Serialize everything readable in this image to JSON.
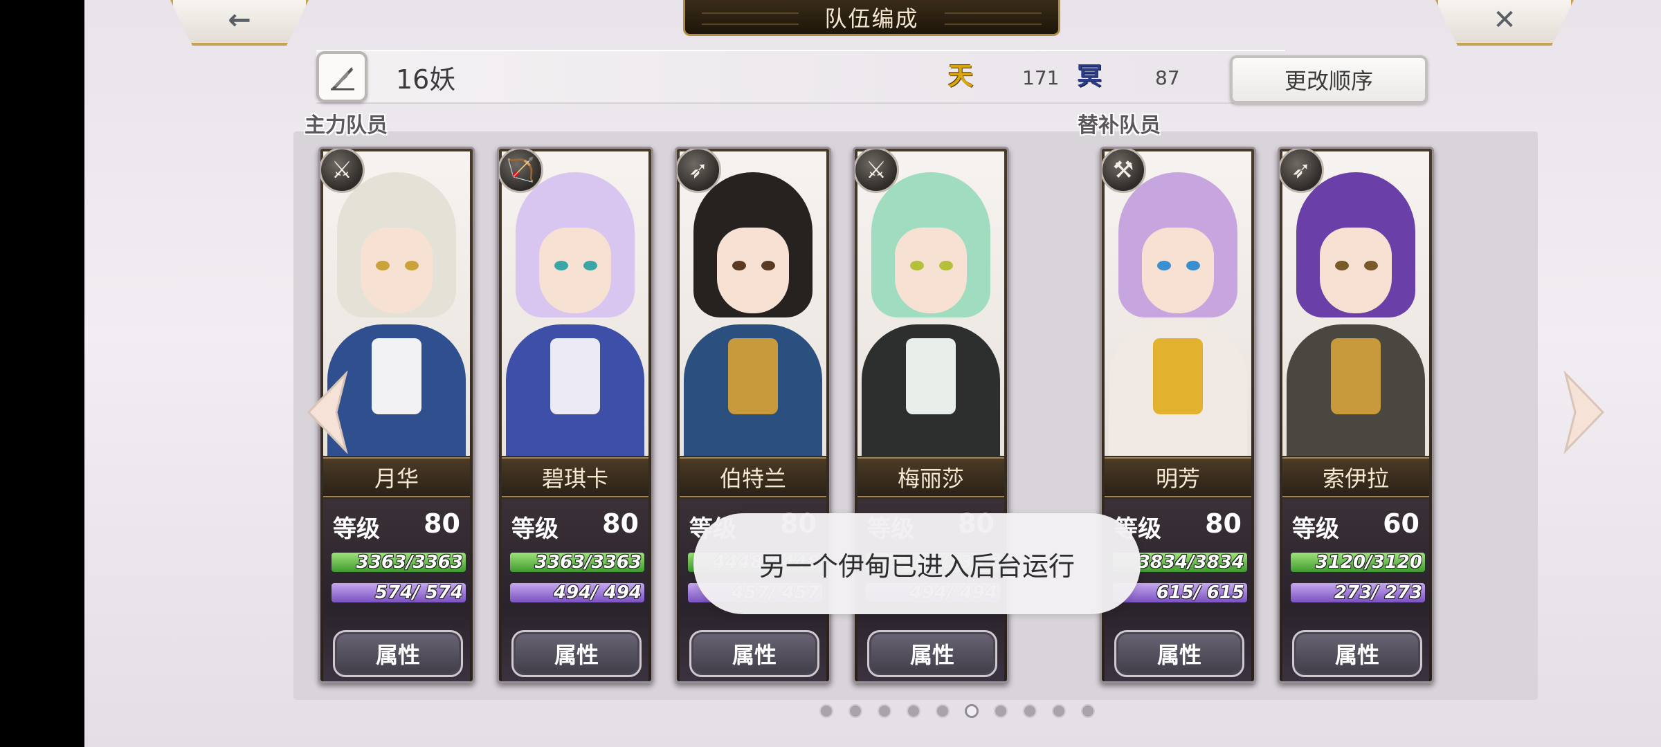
{
  "header": {
    "title": "队伍编成",
    "back_icon": "←",
    "close_icon": "✕"
  },
  "team": {
    "name": "16妖",
    "ten_icon": "天",
    "ten_count": "171",
    "ming_icon": "冥",
    "ming_count": "87",
    "reorder_label": "更改顺序"
  },
  "sections": {
    "main_label": "主力队员",
    "sub_label": "替补队员"
  },
  "cards": [
    {
      "name": "月华",
      "level_label": "等级",
      "level": "80",
      "hp": "3363/3363",
      "mp": "574/ 574",
      "attr_label": "属性",
      "weapon_icon": "⚔",
      "hair": "#e4e2d6",
      "body": "#2f4f8f",
      "accent": "#f2f2f4",
      "eye": "#c9a23a"
    },
    {
      "name": "碧琪卡",
      "level_label": "等级",
      "level": "80",
      "hp": "3363/3363",
      "mp": "494/ 494",
      "attr_label": "属性",
      "weapon_icon": "🏹",
      "hair": "#d9c6f0",
      "body": "#3d4fa6",
      "accent": "#ecebf5",
      "eye": "#3aa6a6"
    },
    {
      "name": "伯特兰",
      "level_label": "等级",
      "level": "80",
      "hp": "4448/4448",
      "mp": "457/ 457",
      "attr_label": "属性",
      "weapon_icon": "➶",
      "hair": "#262220",
      "body": "#2b4f7e",
      "accent": "#c99a3b",
      "eye": "#5a3a22"
    },
    {
      "name": "梅丽莎",
      "level_label": "等级",
      "level": "80",
      "hp": "3363/3363",
      "mp": "494/ 494",
      "attr_label": "属性",
      "weapon_icon": "⚔",
      "hair": "#9fdcc0",
      "body": "#2c2f2e",
      "accent": "#e8eeea",
      "eye": "#b5c03a"
    },
    {
      "name": "明芳",
      "level_label": "等级",
      "level": "80",
      "hp": "3834/3834",
      "mp": "615/ 615",
      "attr_label": "属性",
      "weapon_icon": "⚒",
      "hair": "#c7a6e0",
      "body": "#f0e9e4",
      "accent": "#e2b22f",
      "eye": "#3a8fd0"
    },
    {
      "name": "索伊拉",
      "level_label": "等级",
      "level": "60",
      "hp": "3120/3120",
      "mp": "273/ 273",
      "attr_label": "属性",
      "weapon_icon": "➶",
      "hair": "#6b3fa8",
      "body": "#4a4640",
      "accent": "#c99a3b",
      "eye": "#7a5a2a"
    }
  ],
  "pagination": {
    "count": 10,
    "active": 5
  },
  "toast": "另一个伊甸已进入后台运行",
  "colors": {
    "gold": "#b38d45",
    "hp": "#3f9a2f",
    "mp": "#7a52c0"
  }
}
